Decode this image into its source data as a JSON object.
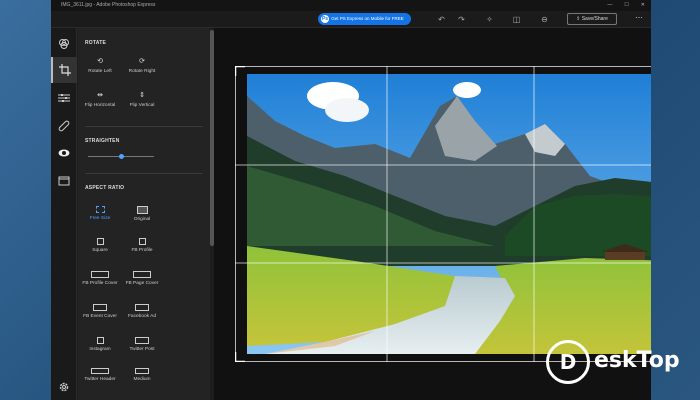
{
  "window": {
    "title": "IMG_3611.jpg - Adobe Photoshop Express"
  },
  "title_controls": [
    "—",
    "☐",
    "✕"
  ],
  "toolbar": {
    "promo_label": "Get PS Express on Mobile for FREE",
    "share_label": "Save/Share",
    "more_label": "⋯"
  },
  "panel": {
    "rotate_header": "ROTATE",
    "rotate_options": [
      {
        "label": "Rotate Left",
        "icon": "rotate-left-icon"
      },
      {
        "label": "Rotate Right",
        "icon": "rotate-right-icon"
      },
      {
        "label": "Flip Horizontal",
        "icon": "flip-horizontal-icon"
      },
      {
        "label": "Flip Vertical",
        "icon": "flip-vertical-icon"
      }
    ],
    "straighten_header": "STRAIGHTEN",
    "straighten_value": 0.5,
    "aspect_header": "ASPECT RATIO",
    "aspect_options": [
      {
        "label": "Free Size",
        "selected": true
      },
      {
        "label": "Original",
        "selected": false
      },
      {
        "label": "Square",
        "selected": false
      },
      {
        "label": "FB Profile",
        "selected": false
      },
      {
        "label": "FB Profile Cover",
        "selected": false
      },
      {
        "label": "FB Page Cover",
        "selected": false
      },
      {
        "label": "FB Event Cover",
        "selected": false
      },
      {
        "label": "Facebook Ad",
        "selected": false
      },
      {
        "label": "Instagram",
        "selected": false
      },
      {
        "label": "Twitter Post",
        "selected": false
      },
      {
        "label": "Twitter Header",
        "selected": false
      },
      {
        "label": "Medium",
        "selected": false
      }
    ]
  },
  "rail_items": [
    "looks-icon",
    "crop-icon",
    "adjust-icon",
    "heal-icon",
    "eye-icon",
    "frame-icon",
    "settings-icon"
  ],
  "watermark": {
    "text": "eskTop",
    "logo_letter": "D"
  },
  "colors": {
    "accent": "#4da3ff",
    "promo": "#1473e6",
    "background": "#1e1e1e"
  }
}
